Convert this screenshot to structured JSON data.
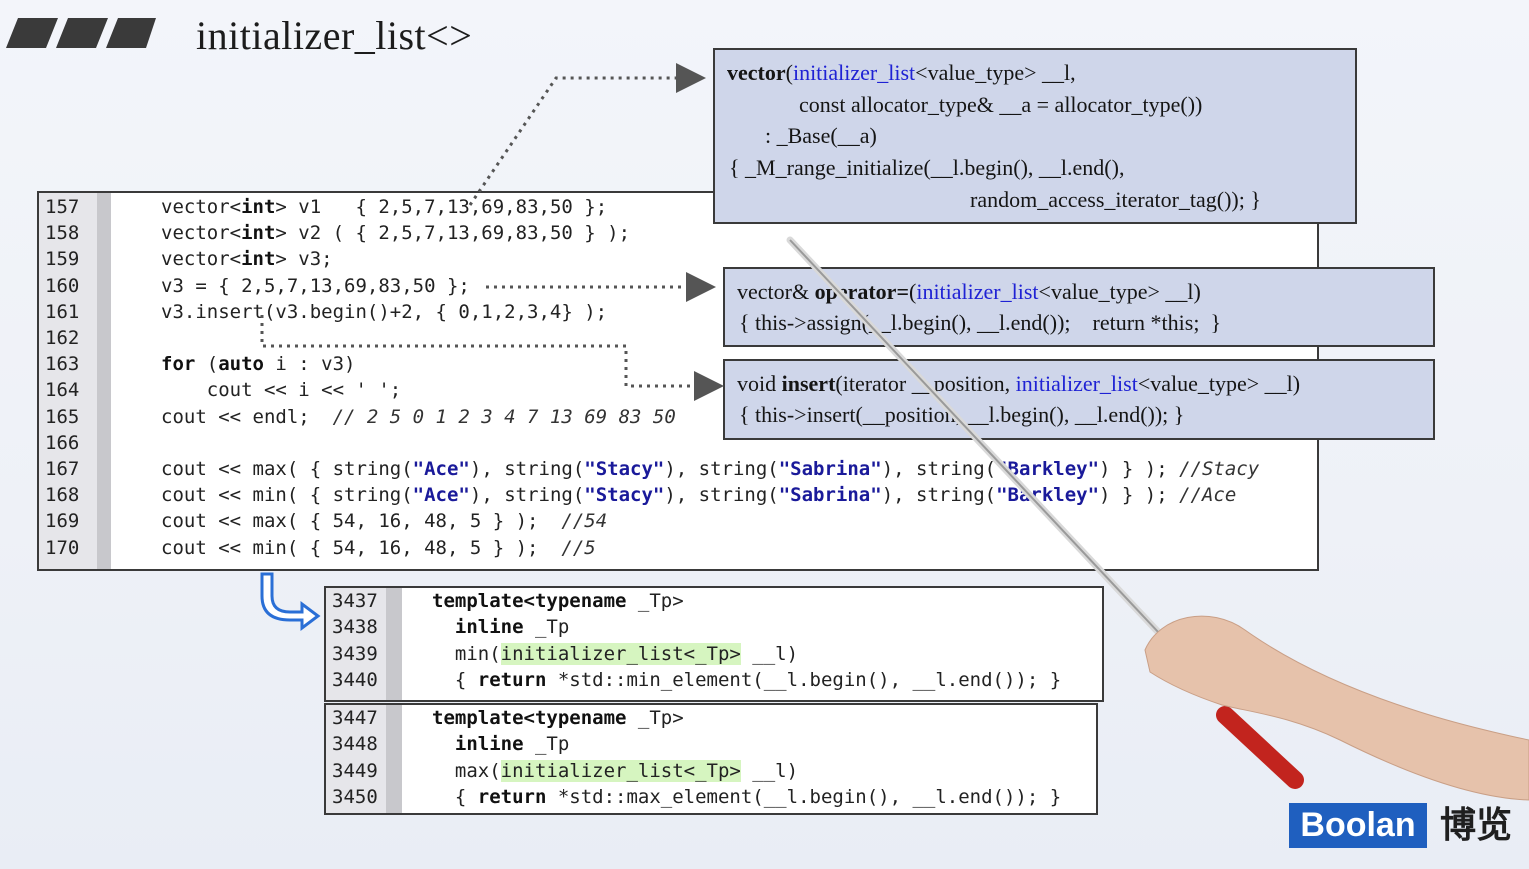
{
  "title": "initializer_list<>",
  "main_code": {
    "lines": [
      {
        "n": "157",
        "parts": [
          {
            "t": "vector<"
          },
          {
            "t": "int",
            "c": "kw"
          },
          {
            "t": "> v1   { 2,5,7,13,69,83,50 };"
          }
        ]
      },
      {
        "n": "158",
        "parts": [
          {
            "t": "vector<"
          },
          {
            "t": "int",
            "c": "kw"
          },
          {
            "t": "> v2 ( { 2,5,7,13,69,83,50 } );"
          }
        ]
      },
      {
        "n": "159",
        "parts": [
          {
            "t": "vector<"
          },
          {
            "t": "int",
            "c": "kw"
          },
          {
            "t": "> v3;"
          }
        ]
      },
      {
        "n": "160",
        "parts": [
          {
            "t": "v3 = { 2,5,7,13,69,83,50 };"
          }
        ]
      },
      {
        "n": "161",
        "parts": [
          {
            "t": "v3.insert(v3.begin()+2, { 0,1,2,3,4} );"
          }
        ]
      },
      {
        "n": "162",
        "parts": [
          {
            "t": ""
          }
        ]
      },
      {
        "n": "163",
        "parts": [
          {
            "t": "for",
            "c": "kw"
          },
          {
            "t": " ("
          },
          {
            "t": "auto",
            "c": "kw"
          },
          {
            "t": " i : v3)"
          }
        ]
      },
      {
        "n": "164",
        "parts": [
          {
            "t": "    cout << i << ' ';"
          }
        ]
      },
      {
        "n": "165",
        "parts": [
          {
            "t": "cout << endl;  "
          },
          {
            "t": "// 2 5 0 1 2 3 4 7 13 69 83 50",
            "c": "cm"
          }
        ]
      },
      {
        "n": "166",
        "parts": [
          {
            "t": ""
          }
        ]
      },
      {
        "n": "167",
        "parts": [
          {
            "t": "cout << max( { string("
          },
          {
            "t": "\"Ace\"",
            "c": "str"
          },
          {
            "t": "), string("
          },
          {
            "t": "\"Stacy\"",
            "c": "str"
          },
          {
            "t": "), string("
          },
          {
            "t": "\"Sabrina\"",
            "c": "str"
          },
          {
            "t": "), string("
          },
          {
            "t": "\"Barkley\"",
            "c": "str"
          },
          {
            "t": ") } ); "
          },
          {
            "t": "//Stacy",
            "c": "cm"
          }
        ]
      },
      {
        "n": "168",
        "parts": [
          {
            "t": "cout << min( { string("
          },
          {
            "t": "\"Ace\"",
            "c": "str"
          },
          {
            "t": "), string("
          },
          {
            "t": "\"Stacy\"",
            "c": "str"
          },
          {
            "t": "), string("
          },
          {
            "t": "\"Sabrina\"",
            "c": "str"
          },
          {
            "t": "), string("
          },
          {
            "t": "\"Barkley\"",
            "c": "str"
          },
          {
            "t": ") } ); "
          },
          {
            "t": "//Ace",
            "c": "cm"
          }
        ]
      },
      {
        "n": "169",
        "parts": [
          {
            "t": "cout << max( { 54, 16, 48, 5 } );  "
          },
          {
            "t": "//54",
            "c": "cm"
          }
        ]
      },
      {
        "n": "170",
        "parts": [
          {
            "t": "cout << min( { 54, 16, 48, 5 } );  "
          },
          {
            "t": "//5",
            "c": "cm"
          }
        ]
      }
    ]
  },
  "vector_ctor_box": {
    "lines": [
      [
        {
          "t": "vector",
          "c": "b"
        },
        {
          "t": "("
        },
        {
          "t": "initializer_list",
          "c": "blue"
        },
        {
          "t": "<value_type> __l,"
        }
      ],
      [
        {
          "t": "const allocator_type& __a = allocator_type())"
        }
      ],
      [
        {
          "t": ": _Base(__a)"
        }
      ],
      [
        {
          "t": "{ _M_range_initialize(__l.begin(), __l.end(),"
        }
      ],
      [
        {
          "t": "random_access_iterator_tag()); }"
        }
      ]
    ]
  },
  "operator_box": {
    "lines": [
      [
        {
          "t": "vector& "
        },
        {
          "t": "operator=",
          "c": "b"
        },
        {
          "t": "("
        },
        {
          "t": "initializer_list",
          "c": "blue"
        },
        {
          "t": "<value_type> __l)"
        }
      ],
      [
        {
          "t": "{ this->assign(__l.begin(), __l.end());    return *this;  }"
        }
      ]
    ]
  },
  "insert_box": {
    "lines": [
      [
        {
          "t": "void "
        },
        {
          "t": "insert",
          "c": "b"
        },
        {
          "t": "(iterator __position, "
        },
        {
          "t": "initializer_list",
          "c": "blue"
        },
        {
          "t": "<value_type> __l)"
        }
      ],
      [
        {
          "t": "{ this->insert(__position, __l.begin(), __l.end()); }"
        }
      ]
    ]
  },
  "min_template": {
    "lines": [
      {
        "n": "3437",
        "parts": [
          {
            "t": "template<typename",
            "c": "kw"
          },
          {
            "t": " _Tp>"
          }
        ]
      },
      {
        "n": "3438",
        "parts": [
          {
            "t": "  "
          },
          {
            "t": "inline",
            "c": "kw"
          },
          {
            "t": " _Tp"
          }
        ]
      },
      {
        "n": "3439",
        "parts": [
          {
            "t": "  min("
          },
          {
            "t": "initializer_list<_Tp>",
            "c": "hl"
          },
          {
            "t": " __l)"
          }
        ]
      },
      {
        "n": "3440",
        "parts": [
          {
            "t": "  { "
          },
          {
            "t": "return",
            "c": "kw"
          },
          {
            "t": " *std::min_element(__l.begin(), __l.end()); }"
          }
        ]
      }
    ]
  },
  "max_template": {
    "lines": [
      {
        "n": "3447",
        "parts": [
          {
            "t": "template<typename",
            "c": "kw"
          },
          {
            "t": " _Tp>"
          }
        ]
      },
      {
        "n": "3448",
        "parts": [
          {
            "t": "  "
          },
          {
            "t": "inline",
            "c": "kw"
          },
          {
            "t": " _Tp"
          }
        ]
      },
      {
        "n": "3449",
        "parts": [
          {
            "t": "  max("
          },
          {
            "t": "initializer_list<_Tp>",
            "c": "hl"
          },
          {
            "t": " __l)"
          }
        ]
      },
      {
        "n": "3450",
        "parts": [
          {
            "t": "  { "
          },
          {
            "t": "return",
            "c": "kw"
          },
          {
            "t": " *std::max_element(__l.begin(), __l.end()); }"
          }
        ]
      }
    ]
  },
  "logo": {
    "text": "Boolan",
    "cn": "博览",
    "color": "#1f5fbf"
  }
}
